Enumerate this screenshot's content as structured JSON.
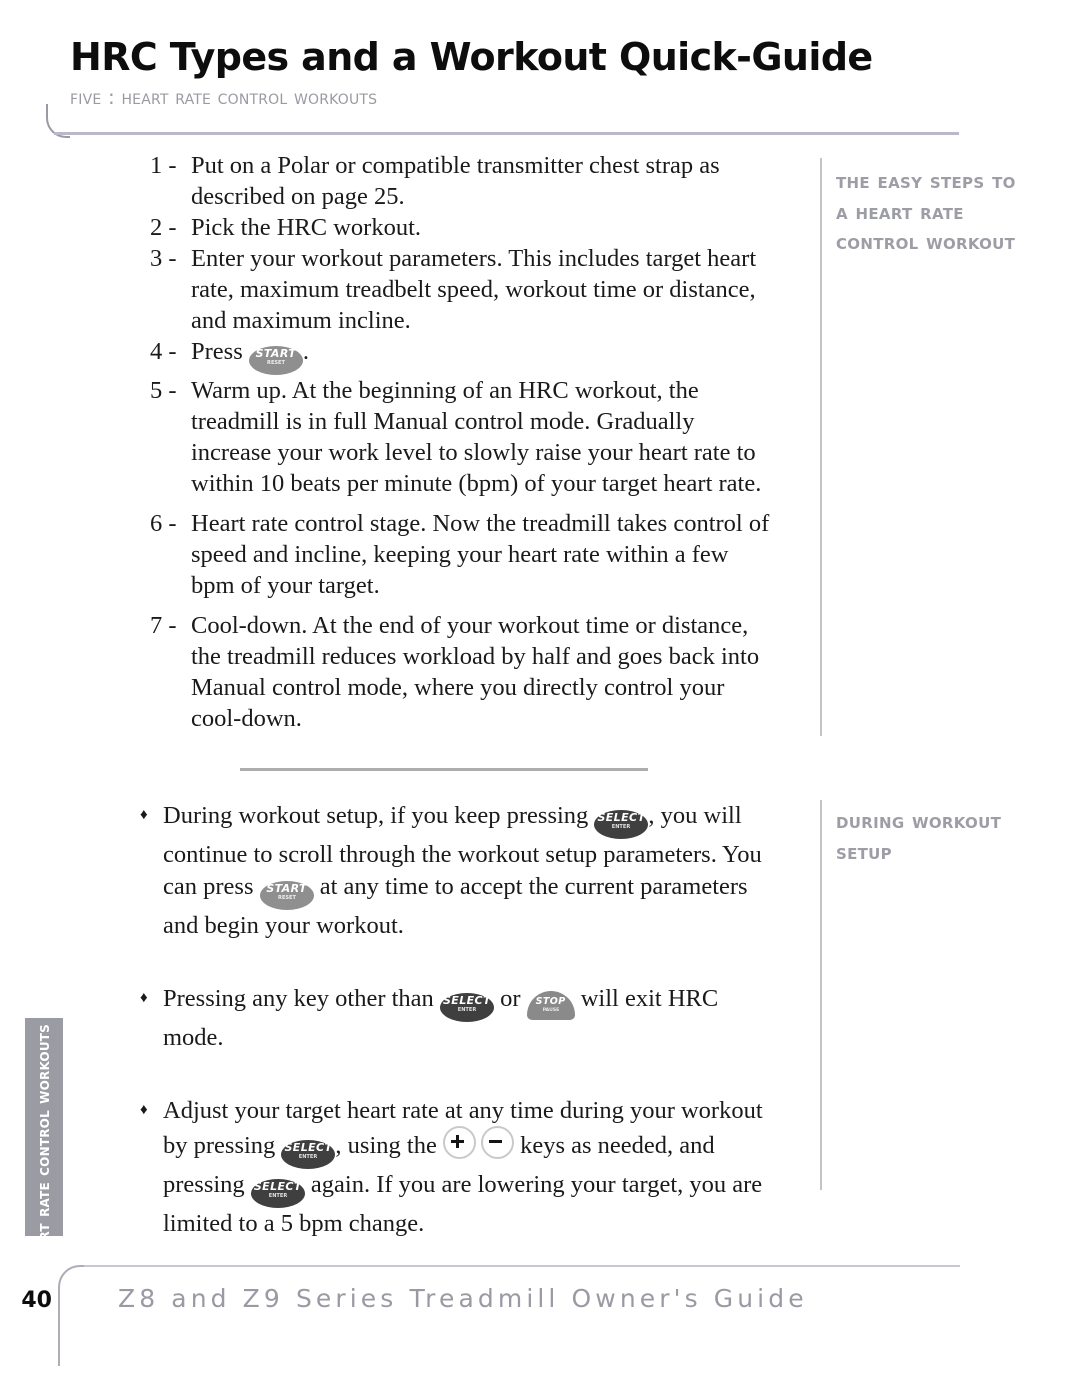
{
  "header": {
    "title": "HRC Types and a Workout Quick-Guide",
    "subtitle": "FIVE : HEART RATE CONTROL WORKOUTS"
  },
  "keys": {
    "start": {
      "name": "start-reset-key",
      "main": "START",
      "sub": "RESET"
    },
    "select": {
      "name": "select-enter-key",
      "main": "SELECT",
      "sub": "ENTER"
    },
    "stop": {
      "name": "stop-pause-key",
      "main": "STOP",
      "sub": "PAUSE"
    },
    "plus": {
      "name": "plus-key",
      "label": "+"
    },
    "minus": {
      "name": "minus-key",
      "label": "−"
    }
  },
  "steps": [
    {
      "num": "1 -",
      "text": "Put on a Polar or compatible transmitter chest strap as described on page 25."
    },
    {
      "num": "2 -",
      "text": "Pick the HRC workout."
    },
    {
      "num": "3 -",
      "text": "Enter your workout parameters. This includes target heart rate, maximum treadbelt speed, workout time or distance, and maximum incline."
    },
    {
      "num": "4 -",
      "text_before": "Press ",
      "text_after": "."
    },
    {
      "num": "5 -",
      "text": "Warm up. At the beginning of an HRC workout, the treadmill is in full Manual control mode. Gradually increase your work level to slowly raise your heart rate to within 10 beats per minute (bpm) of your target heart rate."
    },
    {
      "num": "6 -",
      "text": "Heart rate control stage. Now the treadmill takes control of speed and incline, keeping your heart rate within a few bpm of your target."
    },
    {
      "num": "7 -",
      "text": "Cool-down. At the end of your workout time or distance, the treadmill reduces workload by half and goes back into Manual control mode, where you directly control your cool-down."
    }
  ],
  "bullets": {
    "mark": "♦",
    "b1": {
      "p1": "During workout setup, if you keep pressing ",
      "p2": ", you will continue to scroll through the workout setup parameters. You can press ",
      "p3": " at any time to accept the current parameters and begin your workout."
    },
    "b2": {
      "p1": "Pressing any key other than ",
      "p2": " or ",
      "p3": " will exit HRC mode."
    },
    "b3": {
      "p1": "Adjust your target heart rate at any time during your workout by pressing ",
      "p2": ", using the ",
      "p3": " keys as needed, and pressing ",
      "p4": " again. If you are lowering your target, you are limited to a 5 bpm change."
    }
  },
  "sidebar": {
    "heading_1": "THE EASY STEPS TO A HEART RATE CONTROL WORKOUT",
    "heading_2": "DURING WORKOUT SETUP"
  },
  "left_tab": {
    "label": "HEART RATE CONTROL WORKOUTS"
  },
  "footer": {
    "page_number": "40",
    "text": "Z8 and Z9 Series Treadmill Owner's Guide"
  },
  "colors": {
    "accent_gray": "#9d9da6",
    "rule_lavender": "#b9b9cb",
    "key_dark": "#3f3f3f",
    "key_light": "#8f8f8f",
    "tab_gray": "#9b9ba3"
  }
}
